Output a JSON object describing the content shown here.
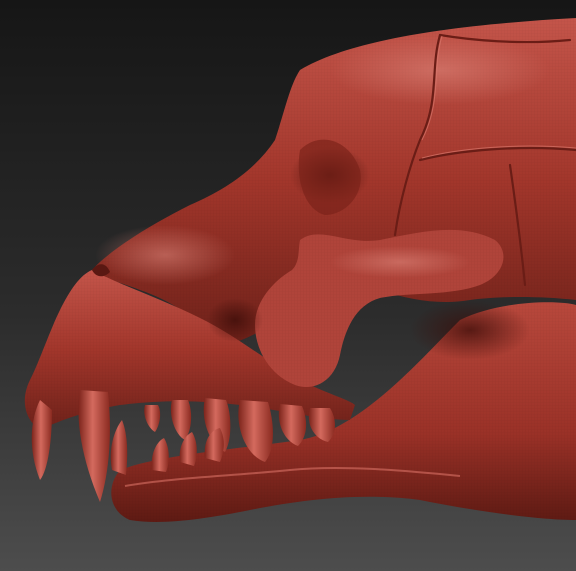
{
  "viewport": {
    "background_top": "#1a1a1a",
    "background_bottom": "#4a4a4a"
  },
  "model": {
    "subject": "carnivore-skull-sculpt",
    "material_color": "#a8372b",
    "material_highlight": "#d0655a",
    "material_shadow": "#5a1812"
  }
}
